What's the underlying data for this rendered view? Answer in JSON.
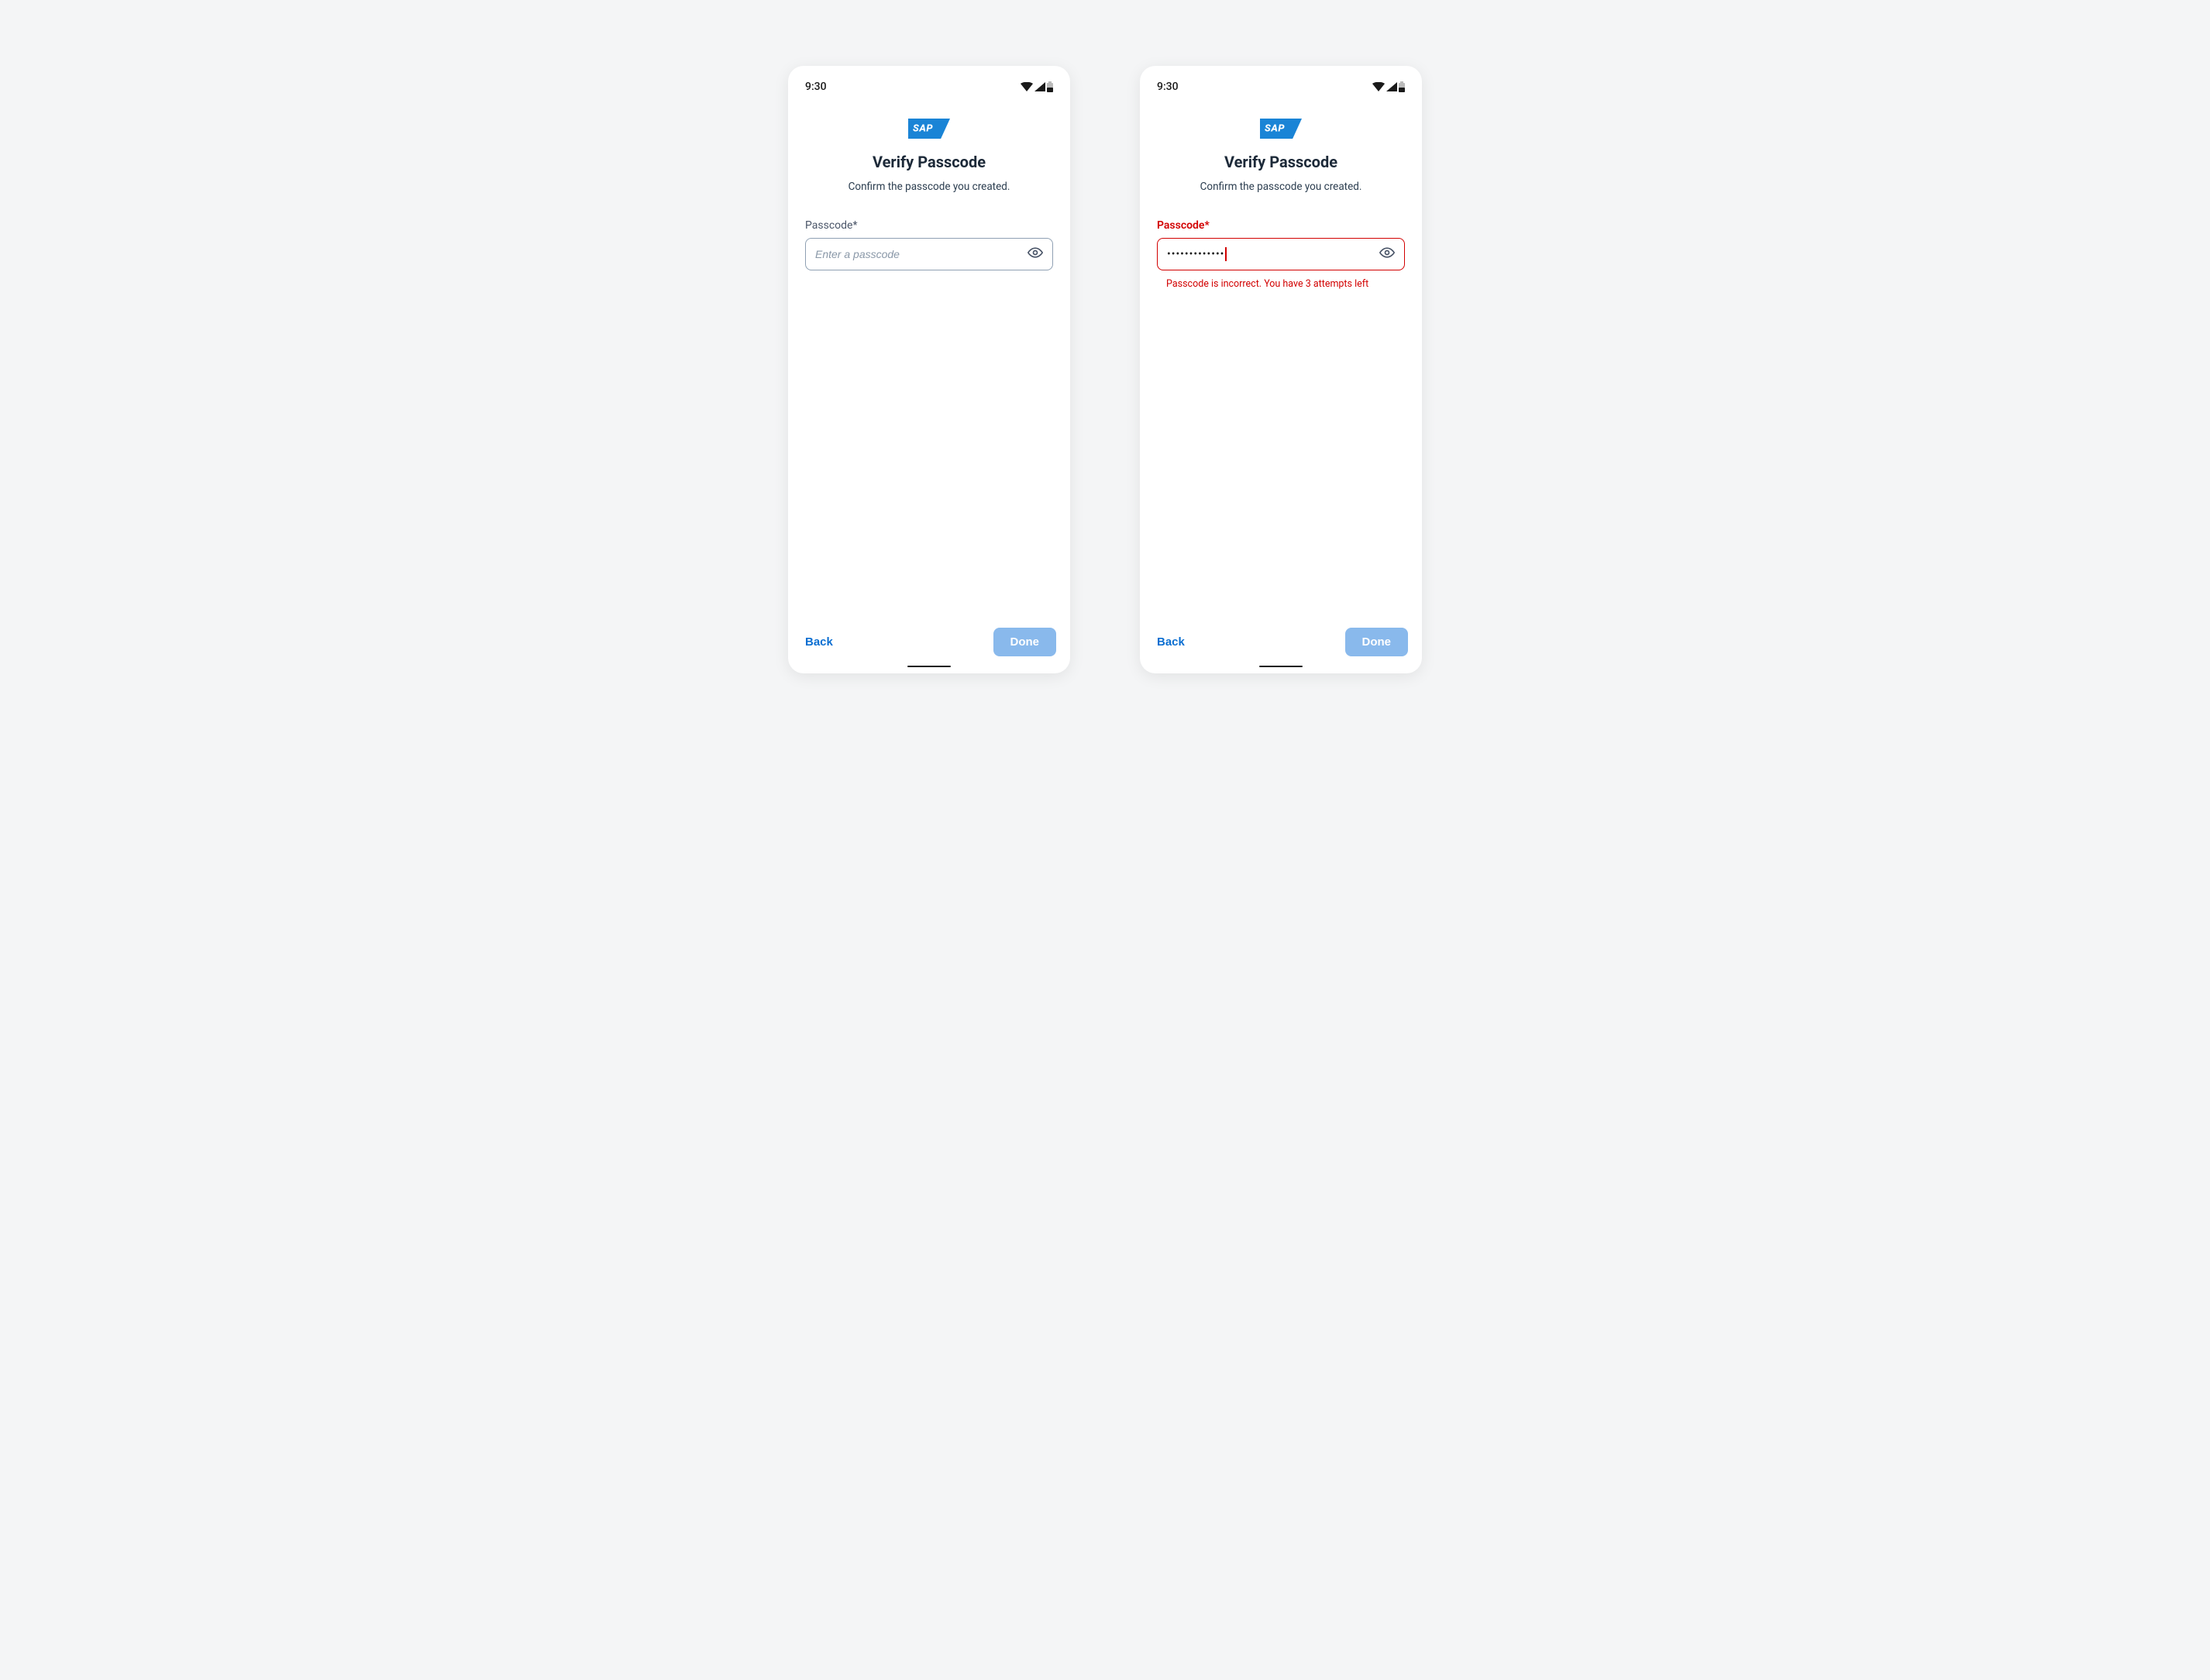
{
  "status": {
    "time": "9:30"
  },
  "logo": {
    "text": "SAP"
  },
  "screen": {
    "title": "Verify Passcode",
    "subtitle": "Confirm the passcode you created.",
    "fieldLabel": "Passcode*",
    "placeholder": "Enter a passcode",
    "maskedValue": "•••••••••••••",
    "errorMessage": "Passcode is incorrect. You have 3 attempts left"
  },
  "footer": {
    "backLabel": "Back",
    "doneLabel": "Done"
  }
}
